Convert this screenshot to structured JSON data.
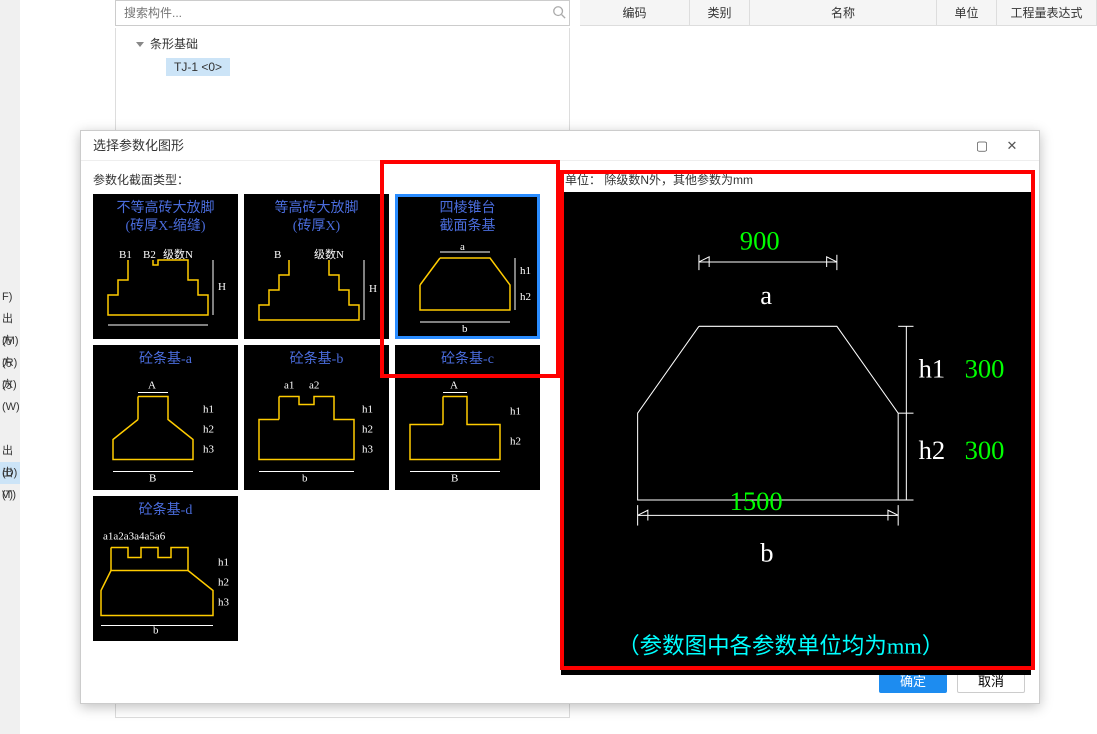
{
  "search": {
    "placeholder": "搜索构件..."
  },
  "tree": {
    "root": "条形基础",
    "child": "TJ-1 <0>"
  },
  "table": {
    "h1": "编码",
    "h2": "类别",
    "h3": "名称",
    "h4": "单位",
    "h5": "工程量表达式"
  },
  "sidebar_labels": [
    "",
    "",
    "",
    "",
    "",
    "",
    "",
    "",
    "",
    "",
    "",
    "",
    "",
    "F)",
    "出(M)",
    "方(R)",
    "方(X)",
    "方(W)",
    "",
    "",
    "出(D)",
    "出(T)",
    "V)"
  ],
  "dialog": {
    "title": "选择参数化图形",
    "left_label": "参数化截面类型：",
    "right_label": "单位： 除级数N外，其他参数为mm",
    "ok": "确定",
    "cancel": "取消"
  },
  "thumbs": [
    {
      "title1": "不等高砖大放脚",
      "title2": "(砖厚X-缩缝)"
    },
    {
      "title1": "等高砖大放脚",
      "title2": "(砖厚X)"
    },
    {
      "title1": "四棱锥台",
      "title2": "截面条基"
    },
    {
      "title1": "砼条基-a",
      "title2": ""
    },
    {
      "title1": "砼条基-b",
      "title2": ""
    },
    {
      "title1": "砼条基-c",
      "title2": ""
    },
    {
      "title1": "砼条基-d",
      "title2": ""
    }
  ],
  "preview": {
    "a_val": "900",
    "a_lbl": "a",
    "b_val": "1500",
    "b_lbl": "b",
    "h1_lbl": "h1",
    "h1_val": "300",
    "h2_lbl": "h2",
    "h2_val": "300",
    "note": "（参数图中各参数单位均为mm）"
  }
}
